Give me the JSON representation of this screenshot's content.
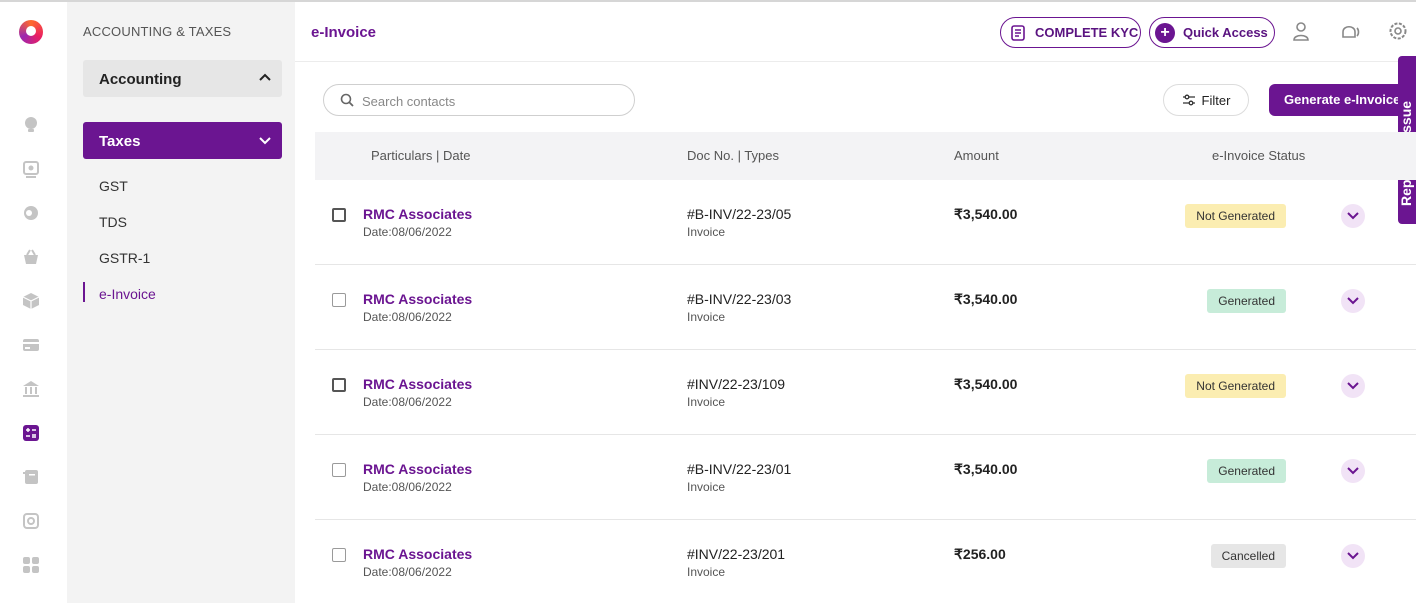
{
  "sidebar": {
    "section_title": "ACCOUNTING & TAXES",
    "accounting_label": "Accounting",
    "taxes_label": "Taxes",
    "items": [
      {
        "label": "GST"
      },
      {
        "label": "TDS"
      },
      {
        "label": "GSTR-1"
      },
      {
        "label": "e-Invoice",
        "active": true
      }
    ]
  },
  "rail_icons": [
    "lightbulb-icon",
    "contact-icon",
    "coins-icon",
    "basket-icon",
    "box-icon",
    "card-icon",
    "bank-icon",
    "calculator-icon",
    "ledger-icon",
    "settings-gear-icon",
    "apps-icon"
  ],
  "header": {
    "title": "e-Invoice",
    "kyc_label": "COMPLETE KYC",
    "quick_access_label": "Quick Access"
  },
  "toolbar": {
    "search_placeholder": "Search contacts",
    "search_value": "",
    "filter_label": "Filter",
    "generate_label": "Generate e-Invoice",
    "report_tab_label": "Report an issue"
  },
  "table": {
    "columns": [
      "Particulars | Date",
      "Doc No. | Types",
      "Amount",
      "e-Invoice Status"
    ],
    "rows": [
      {
        "name": "RMC Associates",
        "date": "Date:08/06/2022",
        "doc_no": "#B-INV/22-23/05",
        "type": "Invoice",
        "amount": "₹3,540.00",
        "status": "Not Generated"
      },
      {
        "name": "RMC Associates",
        "date": "Date:08/06/2022",
        "doc_no": "#B-INV/22-23/03",
        "type": "Invoice",
        "amount": "₹3,540.00",
        "status": "Generated"
      },
      {
        "name": "RMC Associates",
        "date": "Date:08/06/2022",
        "doc_no": "#INV/22-23/109",
        "type": "Invoice",
        "amount": "₹3,540.00",
        "status": "Not Generated"
      },
      {
        "name": "RMC Associates",
        "date": "Date:08/06/2022",
        "doc_no": "#B-INV/22-23/01",
        "type": "Invoice",
        "amount": "₹3,540.00",
        "status": "Generated"
      },
      {
        "name": "RMC Associates",
        "date": "Date:08/06/2022",
        "doc_no": "#INV/22-23/201",
        "type": "Invoice",
        "amount": "₹256.00",
        "status": "Cancelled"
      }
    ]
  },
  "colors": {
    "brand": "#6b1591",
    "not_generated_bg": "#fbedb1",
    "generated_bg": "#c7ecd9",
    "cancelled_bg": "#e6e6e6"
  }
}
